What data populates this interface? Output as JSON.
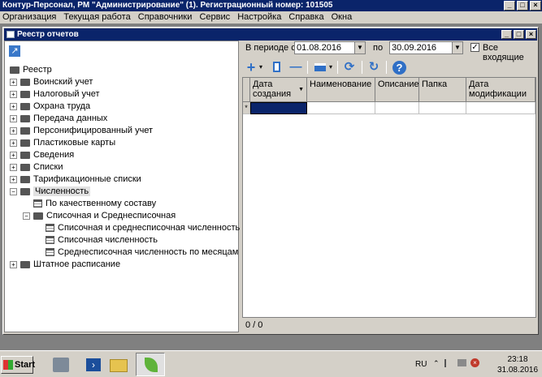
{
  "app": {
    "title": "Контур-Персонал, РМ \"Администрирование\" (1). Регистрационный номер: 101505"
  },
  "menu": [
    "Организация",
    "Текущая работа",
    "Справочники",
    "Сервис",
    "Настройка",
    "Справка",
    "Окна"
  ],
  "child_window": {
    "title": "Реестр отчетов"
  },
  "tree": {
    "root": "Реестр",
    "items": [
      {
        "label": "Воинский учет",
        "level": 1,
        "type": "folder",
        "toggle": "+"
      },
      {
        "label": "Налоговый учет",
        "level": 1,
        "type": "folder",
        "toggle": "+"
      },
      {
        "label": "Охрана труда",
        "level": 1,
        "type": "folder",
        "toggle": "+"
      },
      {
        "label": "Передача данных",
        "level": 1,
        "type": "folder",
        "toggle": "+"
      },
      {
        "label": "Персонифицированный учет",
        "level": 1,
        "type": "folder",
        "toggle": "+"
      },
      {
        "label": "Пластиковые карты",
        "level": 1,
        "type": "folder",
        "toggle": "+"
      },
      {
        "label": "Сведения",
        "level": 1,
        "type": "folder",
        "toggle": "+"
      },
      {
        "label": "Списки",
        "level": 1,
        "type": "folder",
        "toggle": "+"
      },
      {
        "label": "Тарификационные списки",
        "level": 1,
        "type": "folder",
        "toggle": "+"
      },
      {
        "label": "Численность",
        "level": 1,
        "type": "folder",
        "toggle": "-",
        "selected": true
      },
      {
        "label": "По качественному составу",
        "level": 2,
        "type": "report",
        "toggle": ""
      },
      {
        "label": "Списочная и Среднесписочная",
        "level": 2,
        "type": "folder",
        "toggle": "-"
      },
      {
        "label": "Списочная и среднесписочная численность",
        "level": 3,
        "type": "report",
        "toggle": ""
      },
      {
        "label": "Списочная численность",
        "level": 3,
        "type": "report",
        "toggle": ""
      },
      {
        "label": "Среднесписочная численность по месяцам",
        "level": 3,
        "type": "report",
        "toggle": ""
      },
      {
        "label": "Штатное расписание",
        "level": 1,
        "type": "folder",
        "toggle": "+"
      }
    ]
  },
  "filter": {
    "period_label": "В периоде с",
    "date_from": "01.08.2016",
    "to_label": "по",
    "date_to": "30.09.2016",
    "all_incoming_label": "Все входящие",
    "all_incoming_checked": "✓"
  },
  "toolbar": {
    "icons": [
      "plus-icon",
      "copy-icon",
      "minus-icon",
      "print-icon",
      "refresh-icon",
      "refresh-alt-icon",
      "help-icon"
    ],
    "add": "+",
    "remove": "—",
    "help": "?"
  },
  "grid": {
    "columns": [
      "Дата создания",
      "Наименование",
      "Описание",
      "Папка",
      "Дата модификации"
    ],
    "new_row_marker": "*"
  },
  "pager": {
    "text": "0 / 0"
  },
  "taskbar": {
    "start_label": "Start",
    "lang": "RU",
    "time": "23:18",
    "date": "31.08.2016"
  },
  "colors": {
    "titlebar": "#0a246a",
    "face": "#d4d0c8",
    "accent_blue": "#2f6fc6",
    "selected_cell": "#0a246a"
  }
}
